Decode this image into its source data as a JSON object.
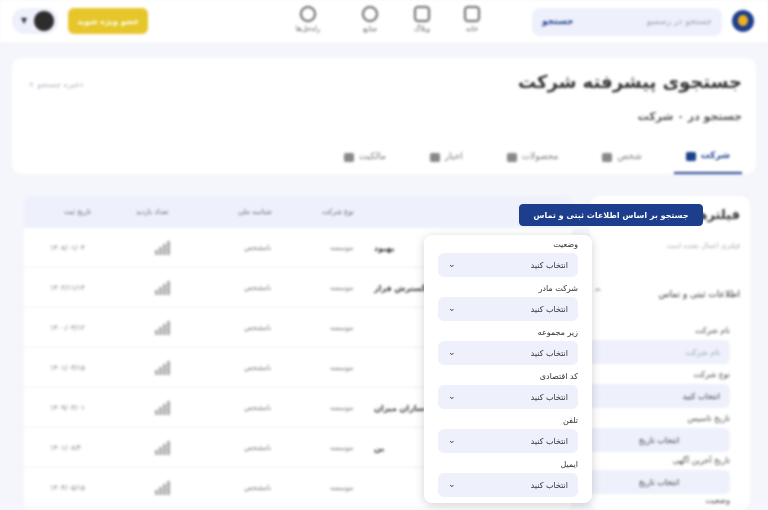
{
  "topbar": {
    "search_button": "جستجو",
    "search_placeholder": "جستجو در رسمیو",
    "nav": [
      {
        "label": "خانه",
        "icon": "home-icon"
      },
      {
        "label": "وبلاگ",
        "icon": "blog-icon"
      },
      {
        "label": "منابع",
        "icon": "resources-icon"
      },
      {
        "label": "راه‌حل‌ها",
        "icon": "bulb-icon"
      }
    ],
    "cta_label": "عضو ویژه شوید"
  },
  "header": {
    "title": "جستجوی پیشرفته شرکت",
    "subtitle": "جستجو در ۰ شرکت",
    "breadcrumb": "ذخیره جستجو",
    "tabs": [
      {
        "label": "شرکت",
        "active": true,
        "icon": "company-icon"
      },
      {
        "label": "شخص",
        "active": false,
        "icon": "person-icon"
      },
      {
        "label": "محصولات",
        "active": false,
        "icon": "cart-icon"
      },
      {
        "label": "اخبار",
        "active": false,
        "icon": "news-icon"
      },
      {
        "label": "مالکیت",
        "active": false,
        "icon": "bulb-icon"
      }
    ]
  },
  "cta_search": "جستجو بر اساس اطلاعات ثبتی و تماس",
  "filters": {
    "title": "فیلترها",
    "note": "فیلتری اعمال نشده است",
    "section": "اطلاعات ثبتی و تماس",
    "fields": [
      {
        "label": "نام شرکت",
        "value": "نام شرکت",
        "placeholder": true
      },
      {
        "label": "نوع شرکت",
        "value": "انتخاب کنید"
      },
      {
        "label": "تاریخ تاسیس",
        "value": "انتخاب تاریخ"
      },
      {
        "label": "تاریخ آخرین آگهی",
        "value": "انتخاب تاریخ"
      },
      {
        "label": "وضعیت",
        "value": ""
      }
    ]
  },
  "table": {
    "headers": [
      "تاریخ ثبت",
      "تعداد بازدید",
      "شناسه ملی",
      "نوع شرکت",
      ""
    ],
    "rows": [
      {
        "date": "۱۴۰۸/۰۱/۰۴",
        "id": "نامشخص",
        "type": "موسسه",
        "name": "بهبود"
      },
      {
        "date": "۱۴۰۲/۱۱/۱۴",
        "id": "نامشخص",
        "type": "موسسه",
        "name": "گسترش فراز"
      },
      {
        "date": "۱۴۰۰/۰۳/۱۲",
        "id": "نامشخص",
        "type": "موسسه",
        "name": ""
      },
      {
        "date": "۱۴۰۱/۰۳/۱۵",
        "id": "نامشخص",
        "type": "موسسه",
        "name": ""
      },
      {
        "date": "۱۴۰۹/۰۳/۰۱",
        "id": "نامشخص",
        "type": "موسسه",
        "name": "سازان میزان ..."
      },
      {
        "date": "۱۴۰۱/۰۸/۴",
        "id": "نامشخص",
        "type": "موسسه",
        "name": "ین"
      },
      {
        "date": "۱۴۰۴/۰۵/۱۵",
        "id": "نامشخص",
        "type": "موسسه",
        "name": ""
      }
    ]
  },
  "dropdown": {
    "items": [
      {
        "label": "وضعیت",
        "value": "انتخاب کنید"
      },
      {
        "label": "شرکت مادر",
        "value": "انتخاب کنید"
      },
      {
        "label": "زیر مجموعه",
        "value": "انتخاب کنید"
      },
      {
        "label": "کد اقتصادی",
        "value": "انتخاب کنید"
      },
      {
        "label": "تلفن",
        "value": "انتخاب کنید"
      },
      {
        "label": "ایمیل",
        "value": "انتخاب کنید"
      }
    ]
  },
  "colors": {
    "primary": "#1c3e8c",
    "accent": "#e6c62a",
    "field_bg": "#eef0fb"
  }
}
